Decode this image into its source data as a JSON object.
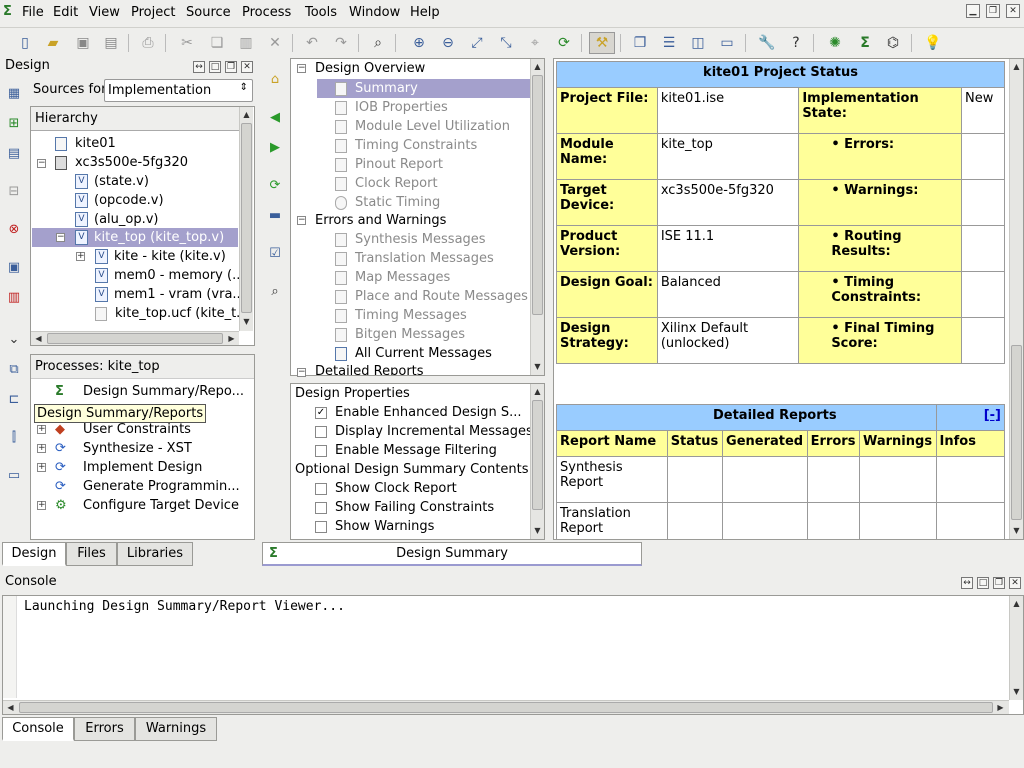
{
  "app": {
    "logo_glyph": "Σ"
  },
  "menu": [
    "File",
    "Edit",
    "View",
    "Project",
    "Source",
    "Process",
    "Tools",
    "Window",
    "Help"
  ],
  "toolbar_icons": [
    "new-file",
    "open",
    "save",
    "save-all",
    "print",
    "cut",
    "copy",
    "paste",
    "delete",
    "undo",
    "redo",
    "find",
    "zoom-in",
    "zoom-out",
    "zoom-fit",
    "zoom-full",
    "zoom-select",
    "refresh",
    "hierarchy-tool",
    "cascade",
    "tile-h",
    "tile-v",
    "windows",
    "settings",
    "help",
    "core-gen",
    "design-summary",
    "schematic",
    "tips"
  ],
  "design_panel": {
    "title": "Design",
    "sources_label": "Sources for:",
    "sources_value": "Implementation",
    "hierarchy_label": "Hierarchy",
    "hierarchy": [
      {
        "label": "kite01",
        "icon": "project"
      },
      {
        "label": "xc3s500e-5fg320",
        "icon": "chip"
      },
      {
        "label": "(state.v)",
        "icon": "v"
      },
      {
        "label": "(opcode.v)",
        "icon": "v"
      },
      {
        "label": "(alu_op.v)",
        "icon": "v"
      },
      {
        "label": "kite_top (kite_top.v)",
        "icon": "v"
      },
      {
        "label": "kite - kite (kite.v)",
        "icon": "v"
      },
      {
        "label": "mem0 - memory (...",
        "icon": "v"
      },
      {
        "label": "mem1 - vram (vra...",
        "icon": "v"
      },
      {
        "label": "kite_top.ucf (kite_t...",
        "icon": "ucf"
      }
    ],
    "processes_label": "Processes: kite_top",
    "processes": [
      {
        "label": "Design Summary/Repo...",
        "icon": "sigma"
      },
      {
        "label": "User Constraints",
        "icon": "constraints"
      },
      {
        "label": "Synthesize - XST",
        "icon": "refresh"
      },
      {
        "label": "Implement Design",
        "icon": "refresh"
      },
      {
        "label": "Generate Programmin...",
        "icon": "refresh"
      },
      {
        "label": "Configure Target Device",
        "icon": "target"
      }
    ],
    "tooltip": "Design Summary/Reports",
    "tabs": [
      "Design",
      "Files",
      "Libraries"
    ]
  },
  "overview": {
    "sections": [
      {
        "label": "Design Overview",
        "items": [
          "Summary",
          "IOB Properties",
          "Module Level Utilization",
          "Timing Constraints",
          "Pinout Report",
          "Clock Report",
          "Static Timing"
        ]
      },
      {
        "label": "Errors and Warnings",
        "items": [
          "Synthesis Messages",
          "Translation Messages",
          "Map Messages",
          "Place and Route Messages",
          "Timing Messages",
          "Bitgen Messages",
          "All Current Messages"
        ]
      },
      {
        "label": "Detailed Reports",
        "items": []
      }
    ],
    "properties_title": "Design Properties",
    "properties": [
      {
        "label": "Enable Enhanced Design S...",
        "checked": true
      },
      {
        "label": "Display Incremental Messages",
        "checked": false
      },
      {
        "label": "Enable Message Filtering",
        "checked": false
      }
    ],
    "optional_title": "Optional Design Summary Contents",
    "optional": [
      {
        "label": "Show Clock Report",
        "checked": false
      },
      {
        "label": "Show Failing Constraints",
        "checked": false
      },
      {
        "label": "Show Warnings",
        "checked": false
      }
    ]
  },
  "status": {
    "title": "kite01 Project Status",
    "rows": [
      {
        "l1": "Project File:",
        "v1": "kite01.ise",
        "l2": "Implementation State:",
        "v2": "New"
      },
      {
        "l1": "Module Name:",
        "v1": "kite_top",
        "l2": "• Errors:",
        "v2": ""
      },
      {
        "l1": "Target Device:",
        "v1": "xc3s500e-5fg320",
        "l2": "• Warnings:",
        "v2": ""
      },
      {
        "l1": "Product Version:",
        "v1": "ISE 11.1",
        "l2": "• Routing Results:",
        "v2": ""
      },
      {
        "l1": "Design Goal:",
        "v1": "Balanced",
        "l2": "• Timing Constraints:",
        "v2": ""
      },
      {
        "l1": "Design Strategy:",
        "v1": "Xilinx Default (unlocked)",
        "l2": "• Final Timing Score:",
        "v2": ""
      }
    ],
    "detailed_title": "Detailed Reports",
    "detailed_toggle": "[-]",
    "detailed_headers": [
      "Report Name",
      "Status",
      "Generated",
      "Errors",
      "Warnings",
      "Infos"
    ],
    "detailed_rows": [
      [
        "Synthesis Report",
        "",
        "",
        "",
        "",
        ""
      ],
      [
        "Translation Report",
        "",
        "",
        "",
        "",
        ""
      ]
    ]
  },
  "editor_tab": "Design Summary",
  "console": {
    "title": "Console",
    "text": "Launching Design Summary/Report Viewer...",
    "tabs": [
      "Console",
      "Errors",
      "Warnings"
    ]
  }
}
